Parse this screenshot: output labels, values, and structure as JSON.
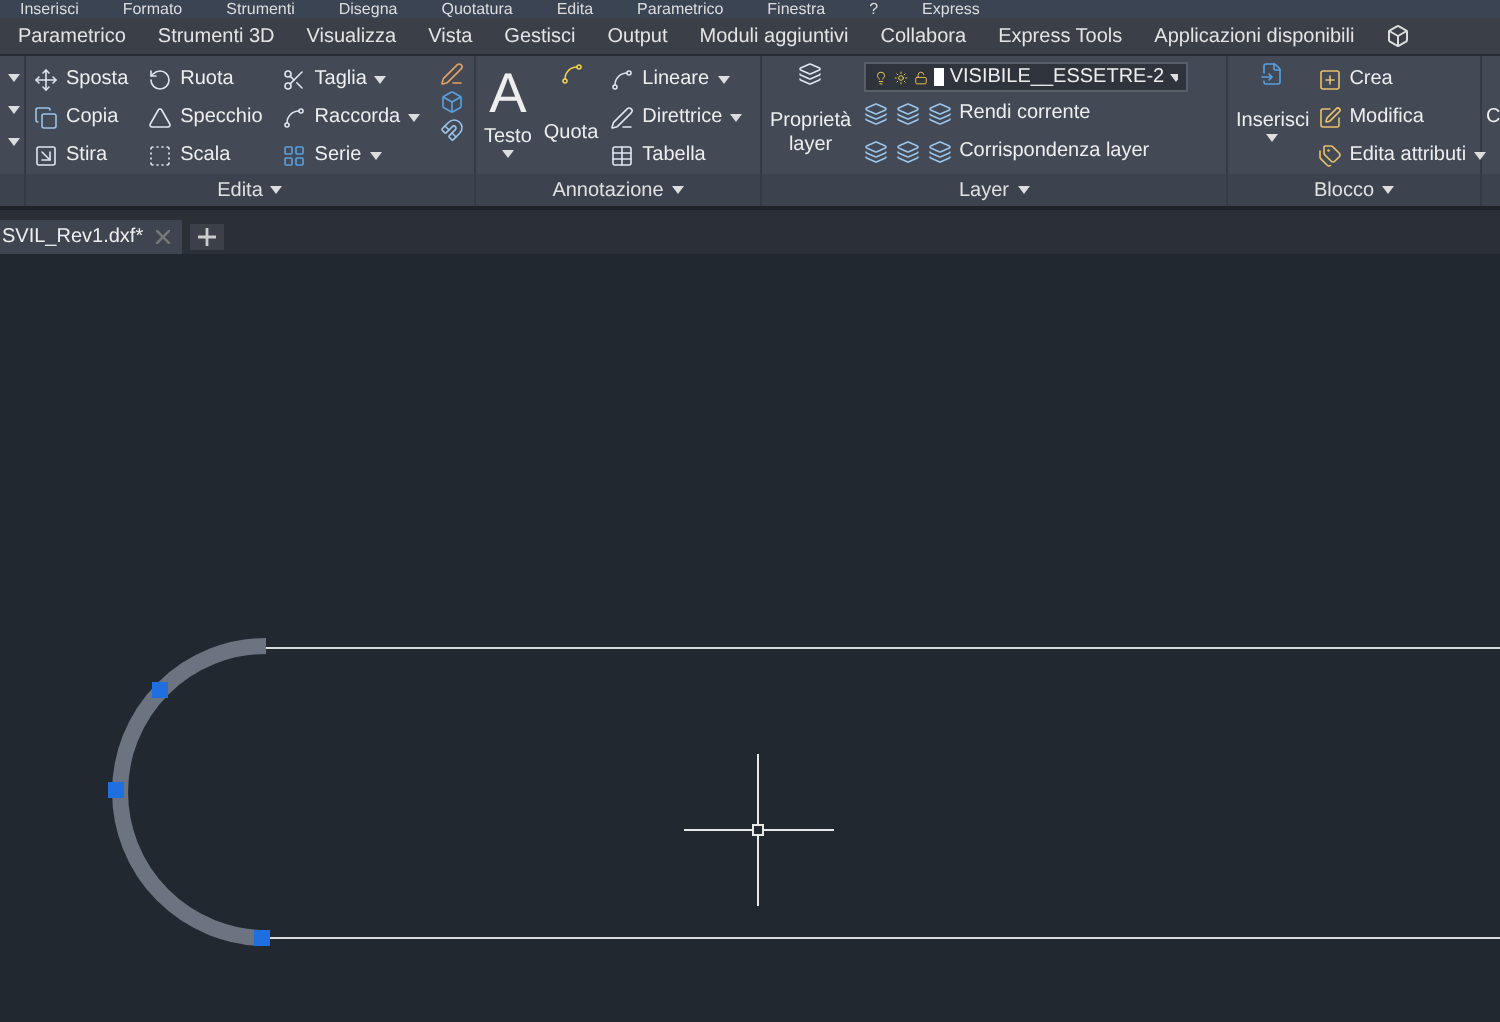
{
  "menu_bar": [
    "Inserisci",
    "Formato",
    "Strumenti",
    "Disegna",
    "Quotatura",
    "Edita",
    "Parametrico",
    "Finestra",
    "?",
    "Express"
  ],
  "ribbon_tabs": [
    "Parametrico",
    "Strumenti 3D",
    "Visualizza",
    "Vista",
    "Gestisci",
    "Output",
    "Moduli aggiuntivi",
    "Collabora",
    "Express Tools",
    "Applicazioni disponibili"
  ],
  "edita": {
    "title": "Edita",
    "columns": [
      [
        {
          "label": "Sposta",
          "dropdown": false
        },
        {
          "label": "Copia",
          "dropdown": false
        },
        {
          "label": "Stira",
          "dropdown": false
        }
      ],
      [
        {
          "label": "Ruota",
          "dropdown": false
        },
        {
          "label": "Specchio",
          "dropdown": false
        },
        {
          "label": "Scala",
          "dropdown": false
        }
      ],
      [
        {
          "label": "Taglia",
          "dropdown": true
        },
        {
          "label": "Raccorda",
          "dropdown": true
        },
        {
          "label": "Serie",
          "dropdown": true
        }
      ]
    ]
  },
  "annotazione": {
    "title": "Annotazione",
    "large": [
      {
        "label": "Testo",
        "glyph": "A",
        "dropdown": true
      },
      {
        "label": "Quota",
        "dropdown": false
      }
    ],
    "small": [
      {
        "label": "Lineare",
        "dropdown": true
      },
      {
        "label": "Direttrice",
        "dropdown": true
      },
      {
        "label": "Tabella",
        "dropdown": false
      }
    ]
  },
  "layer": {
    "title": "Layer",
    "large": {
      "label": "Proprietà\nlayer"
    },
    "current_layer": "VISIBILE__ESSETRE-2",
    "small": [
      "Rendi corrente",
      "Corrispondenza layer"
    ]
  },
  "blocco": {
    "title": "Blocco",
    "large": {
      "label": "Inserisci",
      "dropdown": true
    },
    "small": [
      {
        "label": "Crea",
        "dropdown": false
      },
      {
        "label": "Modifica",
        "dropdown": false
      },
      {
        "label": "Edita attributi",
        "dropdown": true
      }
    ]
  },
  "cut_panel": {
    "label": "C"
  },
  "doc_tabs": [
    {
      "label": "SVIL_Rev1.dxf*",
      "selected": true
    }
  ]
}
